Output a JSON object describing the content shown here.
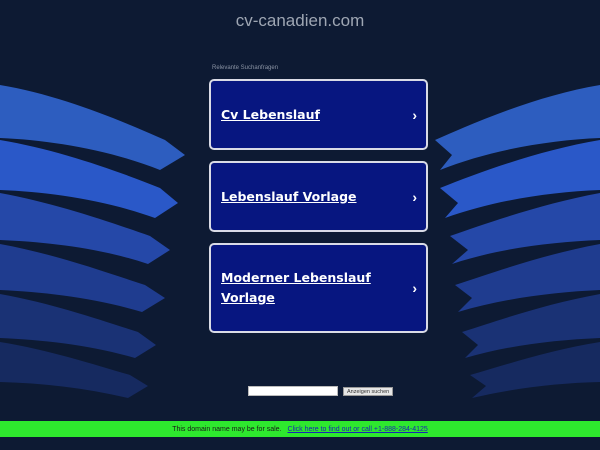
{
  "header": {
    "site_title": "cv-canadien.com"
  },
  "related": {
    "label": "Relevante Suchanfragen",
    "links": [
      {
        "label": "Cv Lebenslauf",
        "chevron": "›"
      },
      {
        "label": "Lebenslauf Vorlage",
        "chevron": "›"
      },
      {
        "label": "Moderner Lebenslauf Vorlage",
        "chevron": "›"
      }
    ]
  },
  "search": {
    "value": "",
    "button_label": "Anzeigen suchen"
  },
  "footer": {
    "text": "This domain name may be for sale.",
    "link_text": "Click here to find out or call +1-888-284-4125"
  },
  "colors": {
    "background": "#0d1a33",
    "link_box": "#071680",
    "footer": "#2ee82e"
  }
}
